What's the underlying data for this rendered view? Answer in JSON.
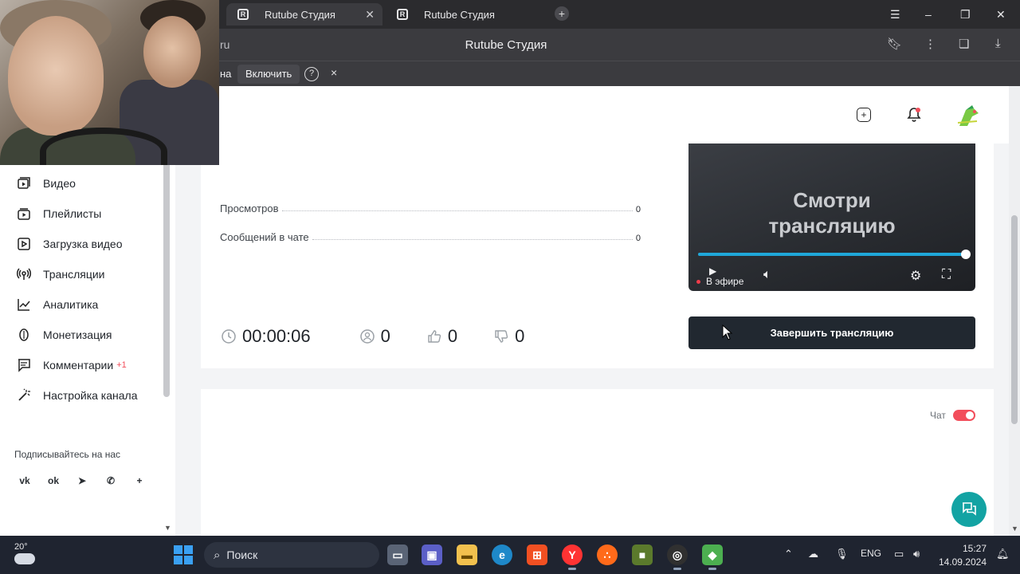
{
  "browser": {
    "tabs": [
      {
        "label": "Rutube Студия",
        "active": true
      },
      {
        "label": "Rutube Студия",
        "active": false
      }
    ],
    "address_fragment": "ru",
    "page_title": "Rutube Студия",
    "infobar": {
      "text_fragment": "на",
      "enable_button": "Включить",
      "help": "?",
      "close": "×"
    }
  },
  "header": {
    "icons": [
      "add-content-icon",
      "notifications-icon",
      "avatar"
    ]
  },
  "sidebar": {
    "items": [
      {
        "label": "Видео",
        "icon": "video-icon"
      },
      {
        "label": "Плейлисты",
        "icon": "playlist-icon"
      },
      {
        "label": "Загрузка видео",
        "icon": "upload-icon"
      },
      {
        "label": "Трансляции",
        "icon": "broadcast-icon"
      },
      {
        "label": "Аналитика",
        "icon": "analytics-icon"
      },
      {
        "label": "Монетизация",
        "icon": "money-icon"
      },
      {
        "label": "Комментарии",
        "icon": "comments-icon",
        "badge": "+1"
      },
      {
        "label": "Настройка канала",
        "icon": "wand-icon"
      }
    ],
    "follow_title": "Подписывайтесь на нас",
    "social": [
      "vk",
      "ok",
      "telegram",
      "viber",
      "more"
    ]
  },
  "stats": [
    {
      "label": "Просмотров",
      "value": "0"
    },
    {
      "label": "Сообщений в чате",
      "value": "0"
    }
  ],
  "counters": {
    "duration": "00:00:06",
    "viewers": "0",
    "likes": "0",
    "dislikes": "0"
  },
  "player": {
    "title_line1": "Смотри",
    "title_line2": "трансляцию",
    "live_label": "В эфире",
    "progress": 1.0,
    "accent": "#1fa7d9"
  },
  "end_button": "Завершить трансляцию",
  "chat": {
    "label": "Чат",
    "enabled": true,
    "toggle_color": "#f24e5b"
  },
  "taskbar": {
    "temperature": "20°",
    "search_placeholder": "Поиск",
    "language": "ENG",
    "time": "15:27",
    "date": "14.09.2024"
  }
}
